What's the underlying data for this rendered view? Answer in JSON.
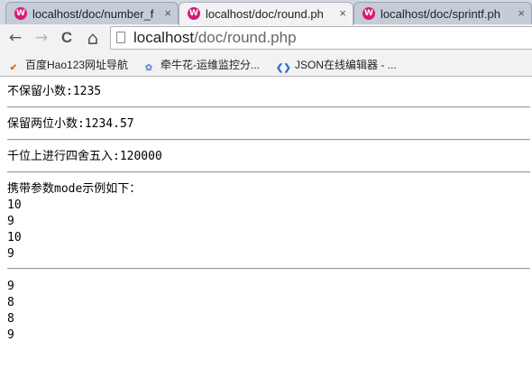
{
  "tabs": [
    {
      "title": "localhost/doc/number_f",
      "active": false
    },
    {
      "title": "localhost/doc/round.ph",
      "active": true
    },
    {
      "title": "localhost/doc/sprintf.ph",
      "active": false
    }
  ],
  "tab_close": "×",
  "tab_favicon": "W",
  "nav": {
    "back_icon": "←",
    "forward_icon": "→",
    "reload_icon": "C",
    "home_icon": "⌂"
  },
  "omnibox": {
    "host": "localhost",
    "path": "/doc/round.php"
  },
  "bookmarks": [
    {
      "label": "百度Hao123网址导航",
      "icon": "hao"
    },
    {
      "label": "牵牛花-运维监控分...",
      "icon": "flower"
    },
    {
      "label": "JSON在线编辑器 - ...",
      "icon": "code"
    }
  ],
  "content": {
    "no_decimal": "不保留小数:1235",
    "two_decimal": "保留两位小数:1234.57",
    "thousands": "千位上进行四舍五入:120000",
    "mode_title": "携带参数mode示例如下：",
    "mode_values_1": [
      "10",
      "9",
      "10",
      "9"
    ],
    "mode_values_2": [
      "9",
      "8",
      "8",
      "9"
    ]
  },
  "colors": {
    "favicon": "#d81b77",
    "tabstrip": "#d3d9e3",
    "toolbar": "#f2f2f2"
  }
}
